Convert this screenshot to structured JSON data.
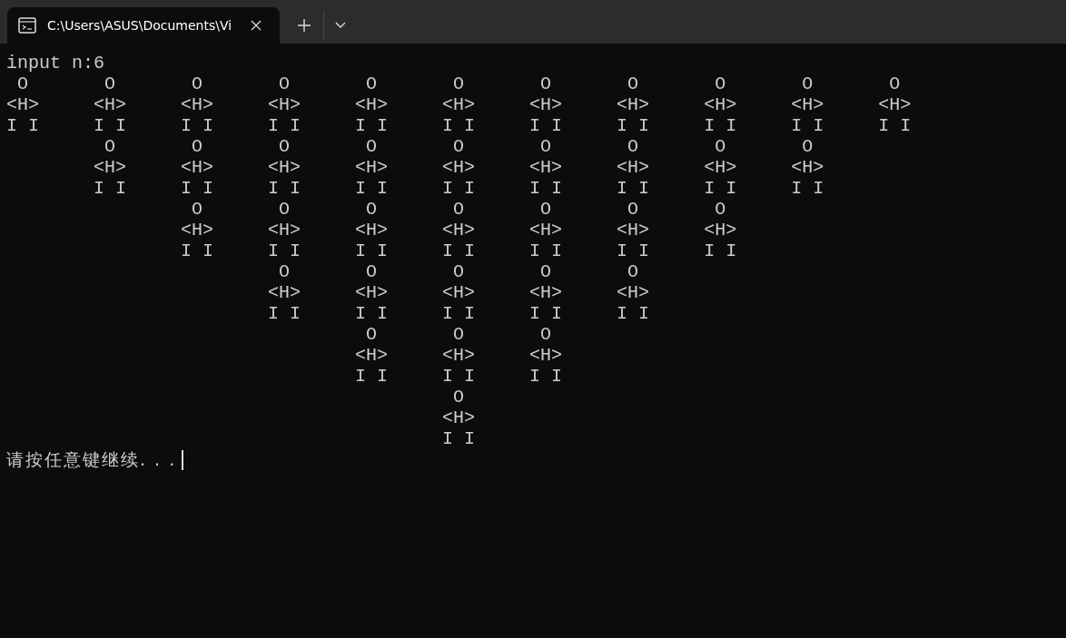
{
  "tab": {
    "title": "C:\\Users\\ASUS\\Documents\\Vi"
  },
  "console": {
    "lines": [
      "input n:6",
      " O       O       O       O       O       O       O       O       O       O       O",
      "<H>     <H>     <H>     <H>     <H>     <H>     <H>     <H>     <H>     <H>     <H>",
      "I I     I I     I I     I I     I I     I I     I I     I I     I I     I I     I I",
      "         O       O       O       O       O       O       O       O       O",
      "        <H>     <H>     <H>     <H>     <H>     <H>     <H>     <H>     <H>",
      "        I I     I I     I I     I I     I I     I I     I I     I I     I I",
      "                 O       O       O       O       O       O       O",
      "                <H>     <H>     <H>     <H>     <H>     <H>     <H>",
      "                I I     I I     I I     I I     I I     I I     I I",
      "                         O       O       O       O       O",
      "                        <H>     <H>     <H>     <H>     <H>",
      "                        I I     I I     I I     I I     I I",
      "                                 O       O       O",
      "                                <H>     <H>     <H>",
      "                                I I     I I     I I",
      "                                         O",
      "                                        <H>",
      "                                        I I"
    ],
    "prompt": "请按任意键继续. . ."
  }
}
